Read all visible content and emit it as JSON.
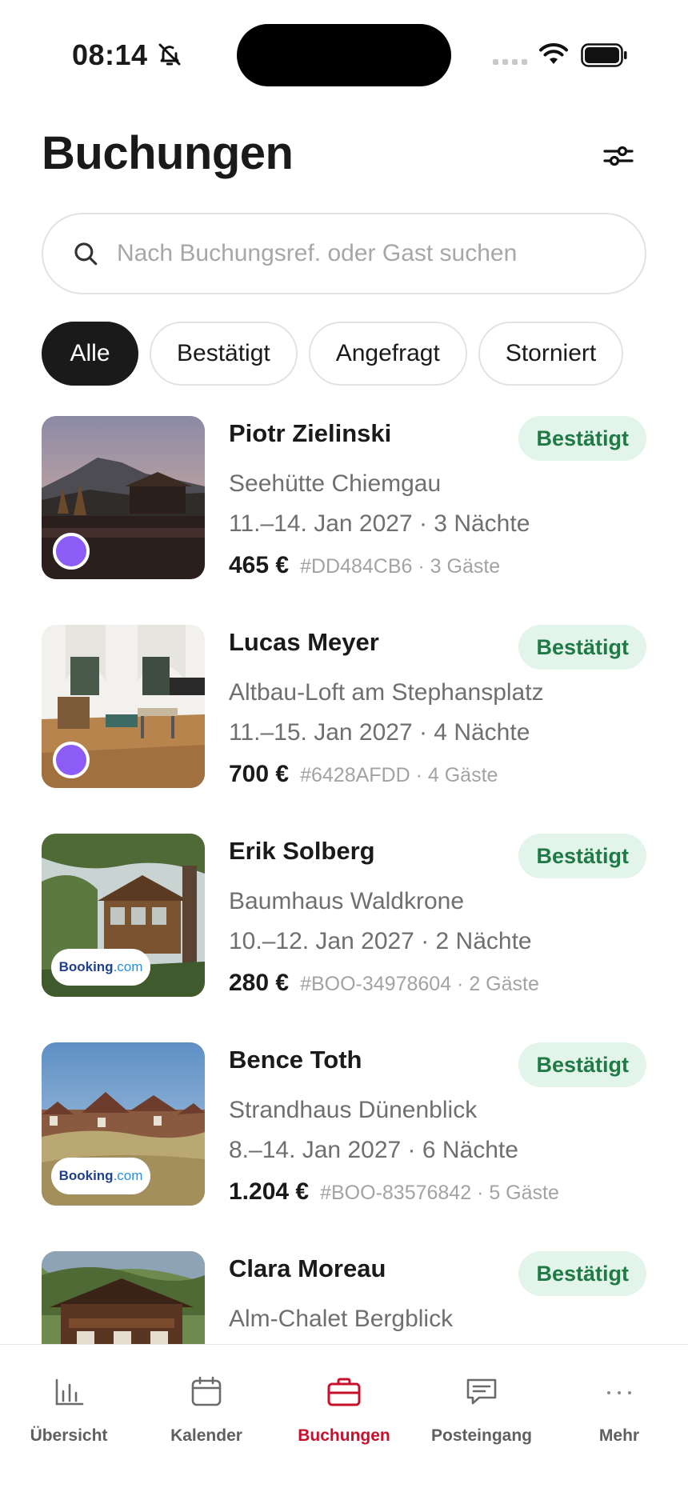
{
  "status_bar": {
    "time": "08:14"
  },
  "header": {
    "title": "Buchungen"
  },
  "search": {
    "placeholder": "Nach Buchungsref. oder Gast suchen"
  },
  "filters": [
    {
      "label": "Alle",
      "active": true
    },
    {
      "label": "Bestätigt",
      "active": false
    },
    {
      "label": "Angefragt",
      "active": false
    },
    {
      "label": "Storniert",
      "active": false
    }
  ],
  "bookings": [
    {
      "guest": "Piotr Zielinski",
      "status": "Bestätigt",
      "property": "Seehütte Chiemgau",
      "dates": "11.–14. Jan 2027 · 3 Nächte",
      "price": "465 €",
      "meta": "#DD484CB6 · 3 Gäste",
      "source": "direct"
    },
    {
      "guest": "Lucas Meyer",
      "status": "Bestätigt",
      "property": "Altbau-Loft am Stephansplatz",
      "dates": "11.–15. Jan 2027 · 4 Nächte",
      "price": "700 €",
      "meta": "#6428AFDD · 4 Gäste",
      "source": "direct"
    },
    {
      "guest": "Erik Solberg",
      "status": "Bestätigt",
      "property": "Baumhaus Waldkrone",
      "dates": "10.–12. Jan 2027 · 2 Nächte",
      "price": "280 €",
      "meta": "#BOO-34978604 · 2 Gäste",
      "source": "Booking.com",
      "source_main": "Booking",
      "source_suffix": ".com"
    },
    {
      "guest": "Bence Toth",
      "status": "Bestätigt",
      "property": "Strandhaus Dünenblick",
      "dates": "8.–14. Jan 2027 · 6 Nächte",
      "price": "1.204 €",
      "meta": "#BOO-83576842 · 5 Gäste",
      "source": "Booking.com",
      "source_main": "Booking",
      "source_suffix": ".com"
    },
    {
      "guest": "Clara Moreau",
      "status": "Bestätigt",
      "property": "Alm-Chalet Bergblick",
      "dates": "",
      "price": "",
      "meta": "",
      "source": "direct"
    }
  ],
  "tabbar": {
    "items": [
      {
        "label": "Übersicht",
        "icon": "bar-chart-icon",
        "active": false
      },
      {
        "label": "Kalender",
        "icon": "calendar-icon",
        "active": false
      },
      {
        "label": "Buchungen",
        "icon": "briefcase-icon",
        "active": true
      },
      {
        "label": "Posteingang",
        "icon": "chat-icon",
        "active": false
      },
      {
        "label": "Mehr",
        "icon": "more-icon",
        "active": false
      }
    ]
  },
  "colors": {
    "accent": "#c8102e",
    "status_green": "#1f7a46",
    "status_green_bg": "#e3f4ea",
    "direct_dot": "#8b5cf6",
    "chip_active_bg": "#1a1a1a"
  }
}
